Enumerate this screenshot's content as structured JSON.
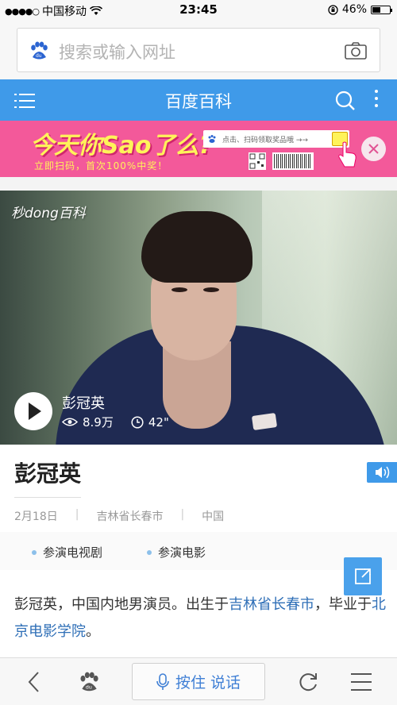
{
  "status_bar": {
    "carrier": "中国移动",
    "time": "23:45",
    "battery": "46%"
  },
  "browser": {
    "search_placeholder": "搜索或输入网址",
    "logo_text": "du"
  },
  "nav": {
    "title": "百度百科"
  },
  "ad": {
    "title": "今天你Sao了么?",
    "subtitle": "立即扫码，首次100%中奖！",
    "input_text": "点击、扫码领取奖品哦 →→"
  },
  "video": {
    "watermark": "秒dong百科",
    "name": "彭冠英",
    "views": "8.9万",
    "duration": "42\""
  },
  "entry": {
    "title": "彭冠英",
    "meta": [
      "2月18日",
      "吉林省长春市",
      "中国"
    ],
    "tabs": [
      "参演电视剧",
      "参演电影"
    ],
    "summary_parts": {
      "p1": "彭冠英，中国内地男演员。出生于",
      "link1": "吉林省长春市",
      "p2": "，毕业于",
      "link2": "北京电影学院",
      "p3": "。"
    }
  },
  "bottom_bar": {
    "voice_label": "按住 说话",
    "logo_text": "du"
  },
  "colors": {
    "accent": "#3f9ae9",
    "ad_bg": "#f3599a",
    "link": "#2f6fb7"
  }
}
